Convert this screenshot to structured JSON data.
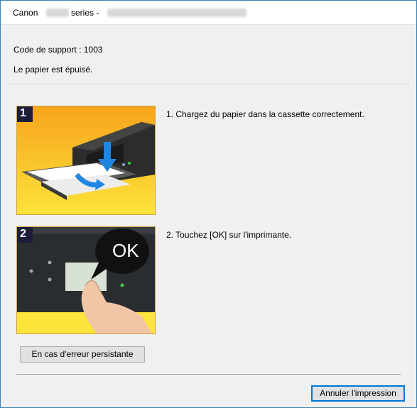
{
  "window": {
    "title_brand": "Canon",
    "title_series": "series -"
  },
  "message": {
    "support_code": "Code de support : 1003",
    "description": "Le papier est épuisé."
  },
  "steps": [
    {
      "badge": "1",
      "text": "1.  Chargez du papier dans la cassette correctement."
    },
    {
      "badge": "2",
      "text": "2.  Touchez [OK] sur l'imprimante.",
      "callout": "OK"
    }
  ],
  "buttons": {
    "persistent_error": "En cas d'erreur persistante",
    "cancel_print": "Annuler l'impression"
  }
}
